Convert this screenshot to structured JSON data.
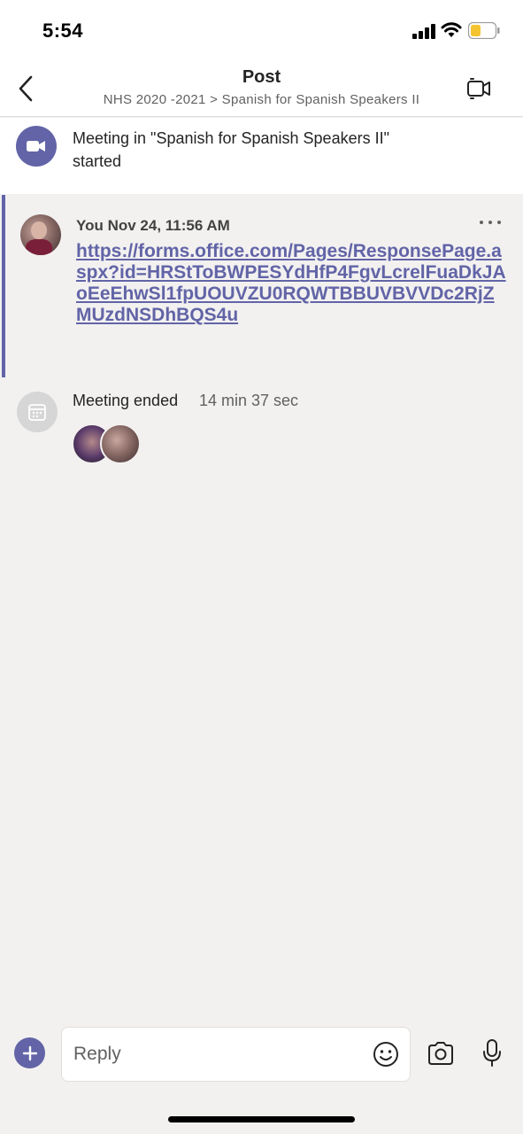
{
  "status_bar": {
    "time": "5:54"
  },
  "nav": {
    "title": "Post",
    "subtitle": "NHS 2020 -2021 > Spanish for Spanish Speakers II"
  },
  "banner": {
    "text": "Meeting in \"Spanish for Spanish Speakers II\"  started"
  },
  "message": {
    "meta": "You Nov 24, 11:56 AM",
    "link": "https://forms.office.com/Pages/ResponsePage.aspx?id=HRStToBWPESYdHfP4FgvLcrelFuaDkJAoEeEhwSl1fpUOUVZU0RQWTBBUVBVVDc2RjZMUzdNSDhBQS4u"
  },
  "meeting_ended": {
    "label": "Meeting ended",
    "duration": "14 min 37 sec"
  },
  "reply": {
    "placeholder": "Reply"
  },
  "colors": {
    "accent": "#6264a7",
    "background": "#f2f1f0"
  },
  "icons": {
    "back": "chevron-left-icon",
    "meet": "video-meeting-icon",
    "banner": "video-camera-icon",
    "calendar": "calendar-icon",
    "add": "plus-icon",
    "emoji": "emoji-icon",
    "camera": "camera-icon",
    "mic": "microphone-icon"
  }
}
